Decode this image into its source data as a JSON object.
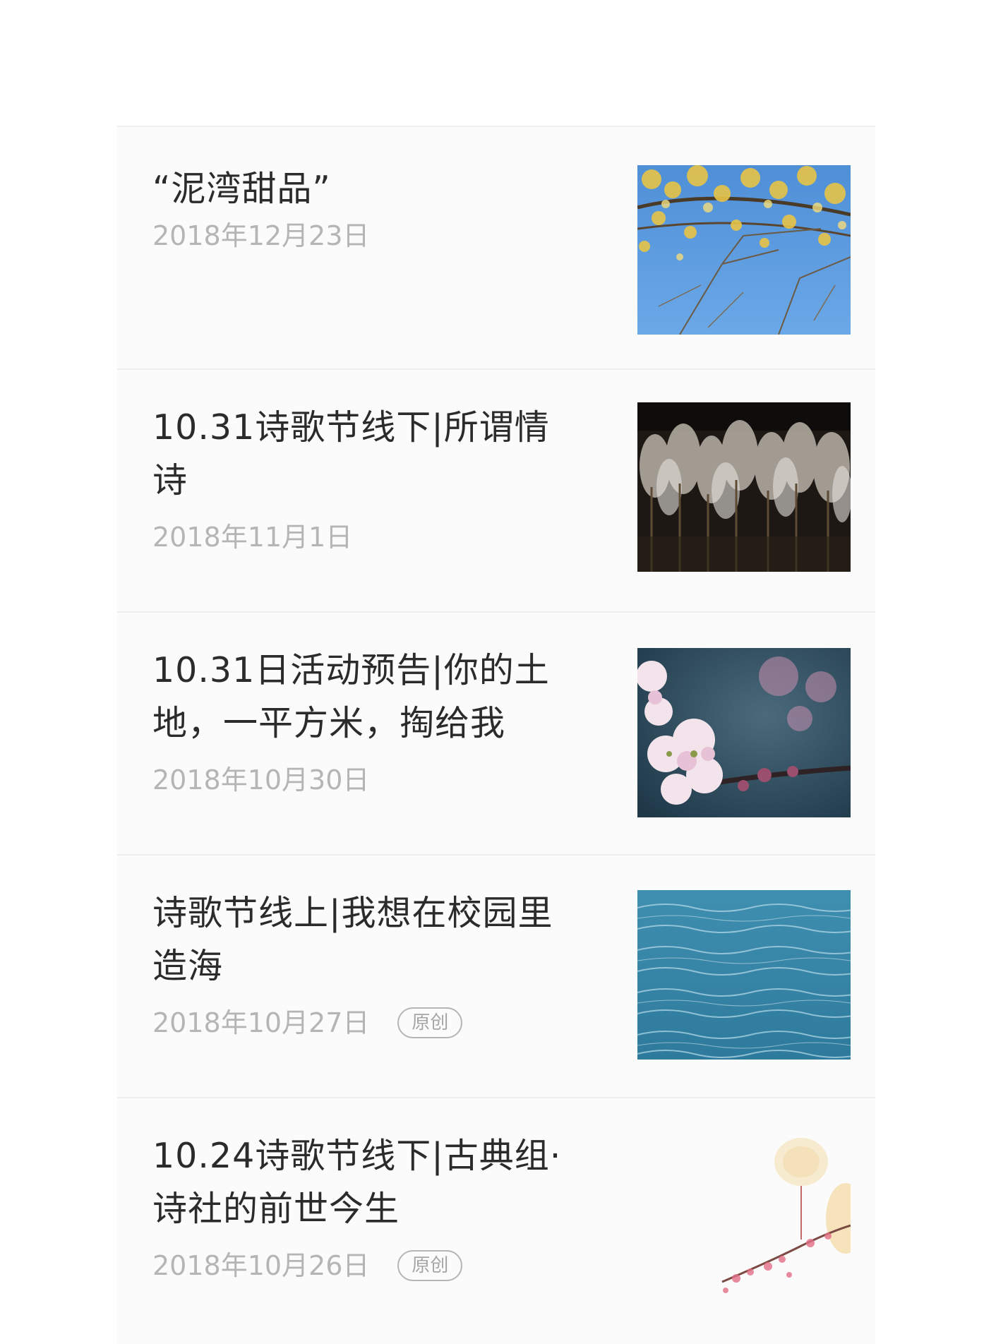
{
  "articles": [
    {
      "title": "“泥湾甜品”",
      "date": "2018年12月23日",
      "badge": "",
      "image_icon": "ginkgo-tree-photo"
    },
    {
      "title": "10.31诗歌节线下|所谓情诗",
      "date": "2018年11月1日",
      "badge": "",
      "image_icon": "frosted-forest-photo"
    },
    {
      "title": "10.31日活动预告|你的土地，一平方米，掏给我",
      "date": "2018年10月30日",
      "badge": "",
      "image_icon": "blossom-photo"
    },
    {
      "title": "诗歌节线上|我想在校园里造海",
      "date": "2018年10月27日",
      "badge": "原创",
      "image_icon": "sea-water-photo"
    },
    {
      "title": "10.24诗歌节线下|古典组·诗社的前世今生",
      "date": "2018年10月26日",
      "badge": "原创",
      "image_icon": "lantern-blossom-photo"
    }
  ]
}
